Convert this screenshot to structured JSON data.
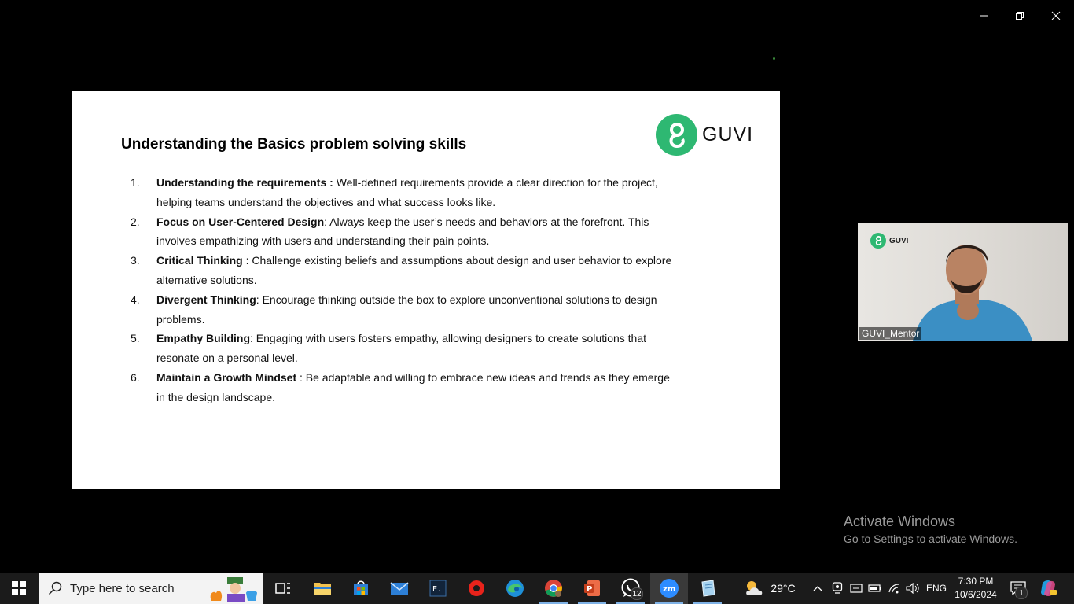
{
  "slide": {
    "title": "Understanding the Basics problem solving skills",
    "logo_text": "GUVI",
    "points": [
      {
        "num": "1.",
        "bold": "Understanding the requirements :",
        "text": " Well-defined requirements provide a clear direction for the project, helping teams understand the objectives and what success looks like."
      },
      {
        "num": "2.",
        "bold": "Focus on User-Centered Design",
        "text": ": Always keep the user’s needs and behaviors at the forefront. This involves empathizing with users and understanding their pain points."
      },
      {
        "num": "3.",
        "bold": "Critical Thinking",
        "text": " :  Challenge existing beliefs and assumptions about design and user behavior to explore alternative solutions."
      },
      {
        "num": "4.",
        "bold": "Divergent Thinking",
        "text": ": Encourage thinking outside the box to explore unconventional solutions to design problems."
      },
      {
        "num": "5.",
        "bold": "Empathy Building",
        "text": ": Engaging with users fosters empathy, allowing designers to create solutions that resonate on a personal level."
      },
      {
        "num": "6.",
        "bold": "Maintain a Growth Mindset",
        "text": " : Be adaptable and willing to embrace new ideas and trends as they emerge in the design landscape."
      }
    ]
  },
  "video": {
    "name_label": "GUVI_Mentor",
    "logo_text": "GUVI"
  },
  "watermark": {
    "line1": "Activate Windows",
    "line2": "Go to Settings to activate Windows."
  },
  "taskbar": {
    "search_placeholder": "Type here to search",
    "weather_temp": "29°C",
    "language": "ENG",
    "time": "7:30 PM",
    "date": "10/6/2024",
    "whatsapp_badge": "12",
    "notification_badge": "1",
    "apps": [
      "task-view",
      "file-explorer",
      "microsoft-store",
      "mail",
      "terminal",
      "recorder",
      "edge",
      "chrome",
      "powerpoint",
      "whatsapp",
      "zoom",
      "notepad"
    ]
  },
  "colors": {
    "guvi_green": "#2eb872",
    "taskbar_bg": "#1b1b1b",
    "zoom_blue": "#2d8cff"
  }
}
